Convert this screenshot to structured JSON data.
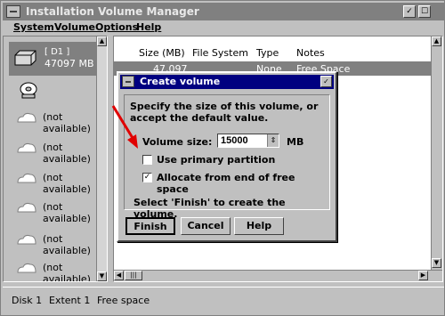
{
  "window": {
    "title": "Installation Volume Manager",
    "title_buttons": [
      "✓",
      "☐"
    ]
  },
  "menu": {
    "items": [
      {
        "label": "System"
      },
      {
        "label": "Volume"
      },
      {
        "label": "Options"
      },
      {
        "label": "Help"
      }
    ]
  },
  "left_pane": {
    "disk": {
      "name": "[ D1 ]",
      "size": "47097 MB"
    },
    "unavailable_label": "(not available)",
    "unavailable_count": 6
  },
  "table": {
    "headers": [
      "Size (MB)",
      "File System",
      "Type",
      "Notes"
    ],
    "selected_row": {
      "size": "47,097",
      "file_system": "",
      "type": "None",
      "notes": "Free Space"
    }
  },
  "dialog": {
    "title": "Create volume",
    "instruction": "Specify the size of this volume, or accept the default value.",
    "volume_size_label": "Volume size:",
    "volume_size_value": "15000",
    "unit": "MB",
    "use_primary_label": "Use primary partition",
    "use_primary_checked": false,
    "allocate_label": "Allocate from end of free space",
    "allocate_checked": true,
    "footer": "Select 'Finish' to create the volume.",
    "buttons": {
      "finish": "Finish",
      "cancel": "Cancel",
      "help": "Help"
    }
  },
  "status": {
    "disk": "Disk  1",
    "extent": "Extent  1",
    "free": "Free space"
  },
  "colors": {
    "window_bg": "#c0c0c0",
    "dialog_title": "#000080",
    "selection": "#808080",
    "annotation_arrow": "#e00000"
  }
}
